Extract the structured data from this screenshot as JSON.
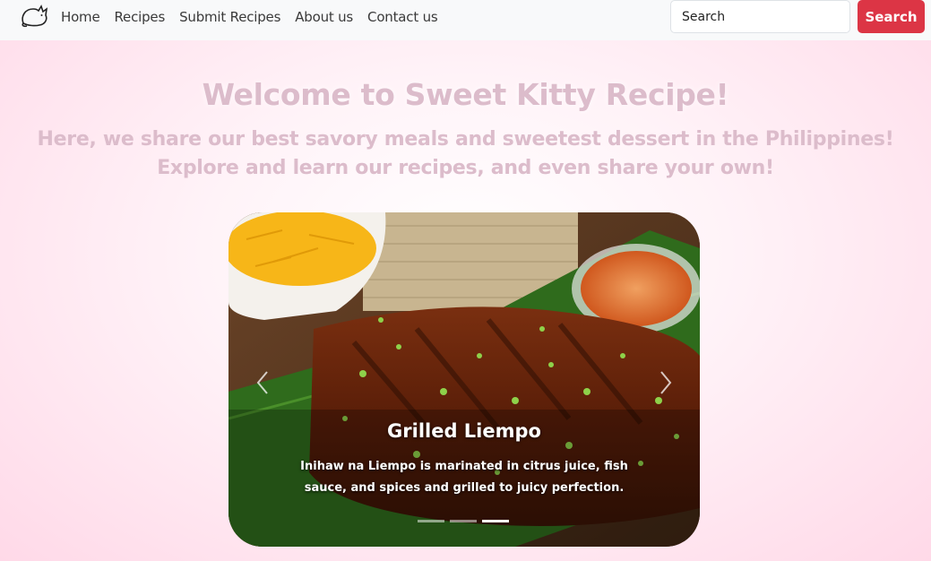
{
  "nav": {
    "logo_icon": "cat-logo-icon",
    "links": [
      "Home",
      "Recipes",
      "Submit Recipes",
      "About us",
      "Contact us"
    ],
    "search_placeholder": "Search",
    "search_button": "Search"
  },
  "hero": {
    "title": "Welcome to Sweet Kitty Recipe!",
    "subtitle_line1": "Here, we share our best savory meals and sweetest dessert in the Philippines!",
    "subtitle_line2": "Explore and learn our recipes, and even share your own!"
  },
  "carousel": {
    "slide_title": "Grilled Liempo",
    "slide_text": "Inihaw na Liempo is marinated in citrus juice, fish sauce, and spices and grilled to juicy perfection.",
    "indicator_count": 3,
    "active_index": 2,
    "prev_icon": "chevron-left-icon",
    "next_icon": "chevron-right-icon"
  },
  "colors": {
    "accent": "#dc3545",
    "title_text": "#dcbccb",
    "navbar_bg": "#f8f9fa"
  }
}
